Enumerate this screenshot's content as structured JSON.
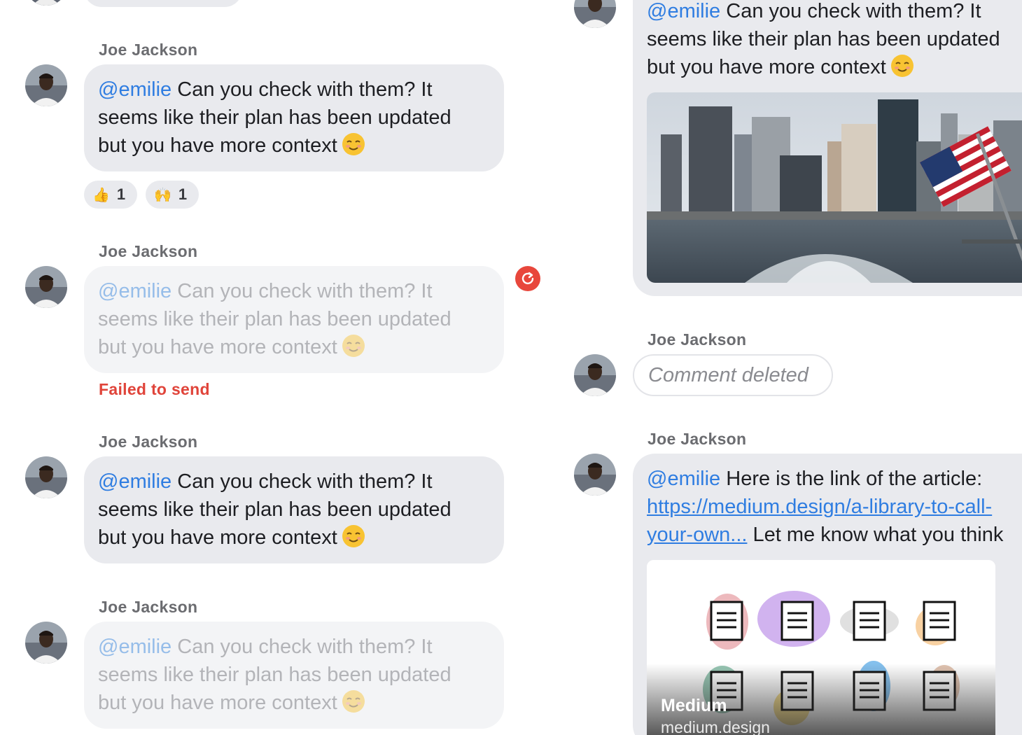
{
  "colors": {
    "bubble": "#e9eaee",
    "bubble_pending": "#f3f4f6",
    "mention": "#2f7de1",
    "error": "#e0443a",
    "sender_name": "#6b6c70"
  },
  "left_column": {
    "messages": [
      {
        "sender": "Joe Jackson",
        "mention": "@emilie",
        "line1": " Can you check with them? It",
        "line2": "seems like their plan has been updated",
        "line3": "but you have more context",
        "emoji": "relieved-face",
        "state": "sent",
        "reactions": [
          {
            "emoji": "👍",
            "count": "1"
          },
          {
            "emoji": "🙌",
            "count": "1"
          }
        ]
      },
      {
        "sender": "Joe Jackson",
        "mention": "@emilie",
        "line1": " Can you check with them? It",
        "line2": "seems like their plan has been updated",
        "line3": "but you have more context",
        "emoji": "relieved-face",
        "state": "failed",
        "status_text": "Failed to send"
      },
      {
        "sender": "Joe Jackson",
        "mention": "@emilie",
        "line1": " Can you check with them? It",
        "line2": "seems like their plan has been updated",
        "line3": "but you have more context",
        "emoji": "relieved-face",
        "state": "sent"
      },
      {
        "sender": "Joe Jackson",
        "mention": "@emilie",
        "line1": " Can you check with them? It",
        "line2": "seems like their plan has been updated",
        "line3": "but you have more context",
        "emoji": "relieved-face",
        "state": "pending"
      }
    ]
  },
  "right_column": {
    "image_message": {
      "mention": "@emilie",
      "line1": " Can you check with them? It",
      "line2": "seems like their plan has been updated",
      "line3": "but you have more context",
      "emoji": "relieved-face",
      "image": "new-york-skyline-photo"
    },
    "deleted_message": {
      "sender": "Joe Jackson",
      "text": "Comment deleted"
    },
    "link_message": {
      "sender": "Joe Jackson",
      "mention": "@emilie",
      "text1": " Here is the link of the article:",
      "link_part1": "https://medium.design/a-library-to-call-",
      "link_part2": "your-own...",
      "text2": " Let me know what you think",
      "preview": {
        "title": "Medium",
        "domain": "medium.design",
        "image": "document-icons-illustration"
      }
    }
  }
}
